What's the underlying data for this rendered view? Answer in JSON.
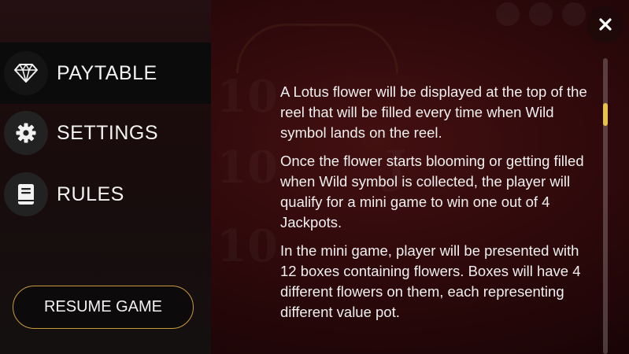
{
  "menu": {
    "items": [
      {
        "label": "PAYTABLE",
        "icon": "diamond-icon",
        "active": true
      },
      {
        "label": "SETTINGS",
        "icon": "gear-icon",
        "active": false
      },
      {
        "label": "RULES",
        "icon": "book-icon",
        "active": false
      }
    ],
    "resume_label": "RESUME GAME"
  },
  "content": {
    "paragraphs": [
      "A Lotus flower will be displayed at the top of the reel that will be filled every time when Wild symbol lands on the reel.",
      "Once the flower starts blooming or getting filled when Wild symbol is collected, the player will qualify for a mini game to win one out of 4 Jackpots.",
      "In the mini game, player will be presented with 12 boxes containing flowers. Boxes will have 4 different flowers on them, each representing different value pot."
    ]
  },
  "close": {
    "icon": "close-icon"
  },
  "colors": {
    "accent": "#c89a3d",
    "scroll_thumb": "#e7c34a",
    "menu_active_bg": "#0b0b0b"
  }
}
